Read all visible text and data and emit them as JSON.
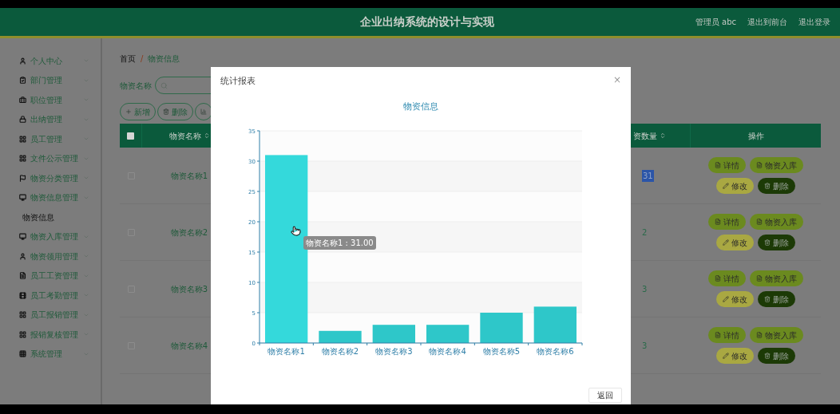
{
  "header": {
    "title": "企业出纳系统的设计与实现",
    "user": "管理员 abc",
    "links": [
      "退出到前台",
      "退出登录"
    ]
  },
  "sidebar": {
    "items": [
      {
        "label": "个人中心"
      },
      {
        "label": "部门管理"
      },
      {
        "label": "职位管理"
      },
      {
        "label": "出纳管理"
      },
      {
        "label": "员工管理"
      },
      {
        "label": "文件公示管理"
      },
      {
        "label": "物资分类管理"
      },
      {
        "label": "物资信息管理",
        "children": [
          {
            "label": "物资信息"
          }
        ]
      },
      {
        "label": "物资入库管理"
      },
      {
        "label": "物资领用管理"
      },
      {
        "label": "员工工资管理"
      },
      {
        "label": "员工考勤管理"
      },
      {
        "label": "员工报销管理"
      },
      {
        "label": "报销复核管理"
      },
      {
        "label": "系统管理"
      }
    ]
  },
  "breadcrumb": [
    "首页",
    "/",
    "物资信息"
  ],
  "search": {
    "label": "物资名称"
  },
  "toolbar": [
    {
      "kind": "add",
      "label": "新增"
    },
    {
      "kind": "delete",
      "label": "删除"
    },
    {
      "kind": "chart"
    }
  ],
  "table": {
    "header_checked": false,
    "columns": [
      {
        "label": "物资名称",
        "sortable": true
      },
      {
        "label": "资数量",
        "sortable": true
      },
      {
        "label": "操作",
        "sortable": false
      }
    ],
    "rows": [
      {
        "checked": false,
        "name": "物资名称1",
        "quantity": "31",
        "quantity_highlighted": true,
        "actions": [
          {
            "kind": "detail",
            "label": "详情"
          },
          {
            "kind": "stock",
            "label": "物资入库"
          },
          {
            "kind": "edit",
            "label": "修改"
          },
          {
            "kind": "delete",
            "label": "删除"
          }
        ]
      },
      {
        "checked": false,
        "name": "物资名称2",
        "quantity": "2",
        "quantity_highlighted": false,
        "actions": [
          {
            "kind": "detail",
            "label": "详情"
          },
          {
            "kind": "stock",
            "label": "物资入库"
          },
          {
            "kind": "edit",
            "label": "修改"
          },
          {
            "kind": "delete",
            "label": "删除"
          }
        ]
      },
      {
        "checked": false,
        "name": "物资名称3",
        "quantity": "3",
        "quantity_highlighted": false,
        "actions": [
          {
            "kind": "detail",
            "label": "详情"
          },
          {
            "kind": "stock",
            "label": "物资入库"
          },
          {
            "kind": "edit",
            "label": "修改"
          },
          {
            "kind": "delete",
            "label": "删除"
          }
        ]
      },
      {
        "checked": false,
        "name": "物资名称4",
        "quantity": "3",
        "quantity_highlighted": false,
        "actions": [
          {
            "kind": "detail",
            "label": "详情"
          },
          {
            "kind": "stock",
            "label": "物资入库"
          },
          {
            "kind": "edit",
            "label": "修改"
          },
          {
            "kind": "delete",
            "label": "删除"
          }
        ]
      }
    ]
  },
  "dialog": {
    "title": "统计报表",
    "close": "×",
    "tooltip": "物资名称1 : 31.00",
    "return_button": "返回",
    "chart_data": {
      "type": "bar",
      "title": "物资信息",
      "categories": [
        "物资名称1",
        "物资名称2",
        "物资名称3",
        "物资名称4",
        "物资名称5",
        "物资名称6"
      ],
      "values": [
        31,
        2,
        3,
        3,
        5,
        6
      ],
      "grid": true,
      "ylim": [
        0,
        35
      ],
      "yticks": [
        0,
        5,
        10,
        15,
        20,
        25,
        30,
        35
      ]
    }
  }
}
